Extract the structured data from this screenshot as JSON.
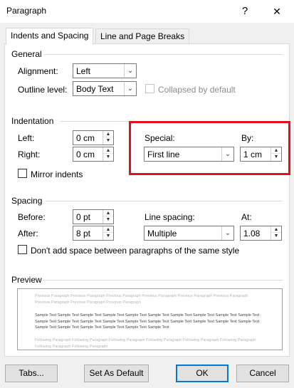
{
  "window": {
    "title": "Paragraph",
    "help_glyph": "?",
    "close_glyph": "✕"
  },
  "tabs": [
    {
      "label": "Indents and Spacing",
      "active": true
    },
    {
      "label": "Line and Page Breaks",
      "active": false
    }
  ],
  "general": {
    "heading": "General",
    "alignment": {
      "label": "Alignment:",
      "value": "Left"
    },
    "outline_level": {
      "label": "Outline level:",
      "value": "Body Text"
    },
    "collapsed": {
      "label": "Collapsed by default",
      "checked": false,
      "enabled": false
    }
  },
  "indentation": {
    "heading": "Indentation",
    "left": {
      "label": "Left:",
      "value": "0 cm"
    },
    "right": {
      "label": "Right:",
      "value": "0 cm"
    },
    "mirror": {
      "label": "Mirror indents",
      "checked": false
    },
    "special": {
      "label": "Special:",
      "value": "First line"
    },
    "by": {
      "label": "By:",
      "value": "1 cm"
    }
  },
  "spacing": {
    "heading": "Spacing",
    "before": {
      "label": "Before:",
      "value": "0 pt"
    },
    "after": {
      "label": "After:",
      "value": "8 pt"
    },
    "line_spacing": {
      "label": "Line spacing:",
      "value": "Multiple"
    },
    "at": {
      "label": "At:",
      "value": "1.08"
    },
    "dont_add": {
      "label": "Don't add space between paragraphs of the same style",
      "checked": false
    }
  },
  "preview": {
    "heading": "Preview",
    "previous_text": "Previous Paragraph Previous Paragraph Previous Paragraph Previous Paragraph Previous Paragraph Previous Paragraph Previous Paragraph Previous Paragraph Previous Paragraph",
    "sample_text": "Sample Text Sample Text Sample Text Sample Text Sample Text Sample Text Sample Text Sample Text Sample Text Sample Text Sample Text Sample Text Sample Text Sample Text Sample Text Sample Text Sample Text Sample Text Sample Text Sample Text Sample Text Sample Text Sample Text Sample Text Sample Text Sample Text",
    "following_text": "Following Paragraph Following Paragraph Following Paragraph Following Paragraph Following Paragraph Following Paragraph Following Paragraph Following Paragraph"
  },
  "buttons": {
    "tabs": "Tabs...",
    "set_default": "Set As Default",
    "ok": "OK",
    "cancel": "Cancel"
  },
  "colors": {
    "highlight": "#e1121b",
    "accent": "#0078d7"
  }
}
